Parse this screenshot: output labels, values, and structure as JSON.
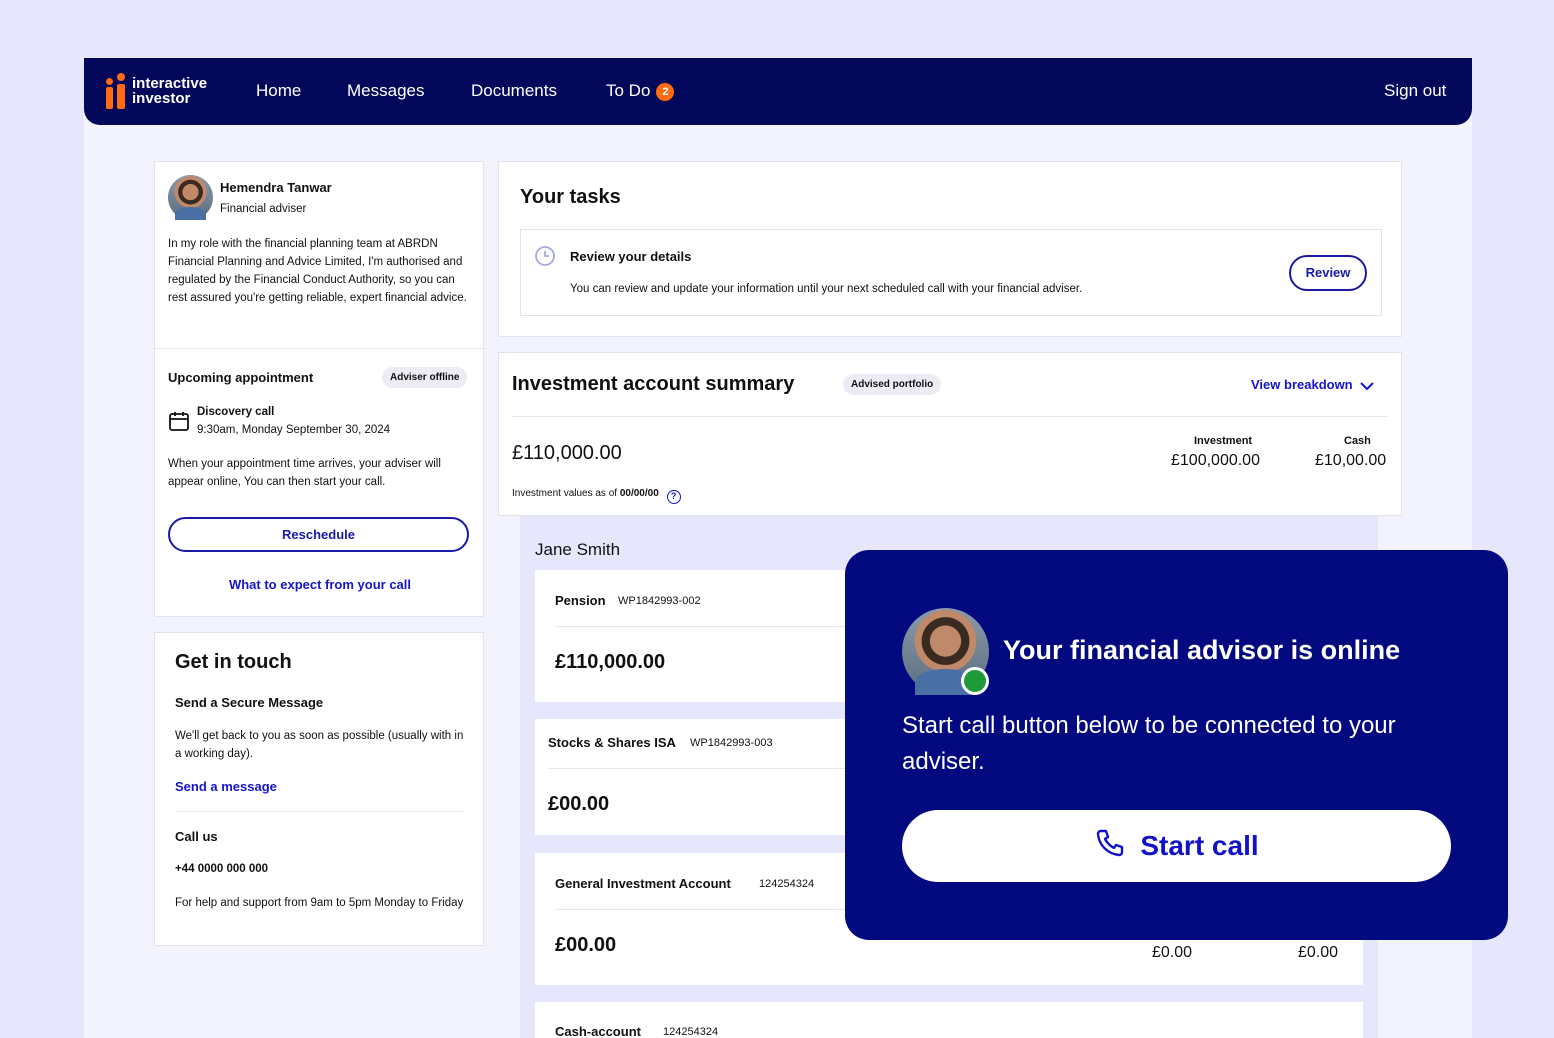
{
  "nav": {
    "logo_line1": "interactive",
    "logo_line2": "investor",
    "home": "Home",
    "messages": "Messages",
    "documents": "Documents",
    "todo": "To Do",
    "todo_count": "2",
    "sign_out": "Sign out"
  },
  "adviser": {
    "name": "Hemendra Tanwar",
    "role": "Financial adviser",
    "bio": "In my role with the financial planning team at ABRDN Financial Planning and Advice Limited, I'm authorised and regulated by the Financial Conduct Authority, so you can rest assured you're getting reliable, expert financial advice."
  },
  "appointment": {
    "heading": "Upcoming appointment",
    "status": "Adviser offline",
    "type": "Discovery call",
    "datetime": "9:30am, Monday September 30, 2024",
    "note": "When your appointment time arrives, your adviser will appear online, You can then start your call.",
    "reschedule": "Reschedule",
    "expect_link": "What to expect from your call"
  },
  "contact": {
    "heading": "Get in touch",
    "secure_heading": "Send a Secure Message",
    "secure_text": "We'll get back to you as soon as possible (usually with in a working day).",
    "send_link": "Send a message",
    "call_heading": "Call us",
    "phone": "+44 0000 000 000",
    "hours": "For help and support from 9am to 5pm Monday to Friday"
  },
  "tasks": {
    "heading": "Your tasks",
    "item_title": "Review your details",
    "item_text": "You can review and update your information until your next scheduled call with your financial adviser.",
    "review_btn": "Review"
  },
  "summary": {
    "heading": "Investment account summary",
    "tag": "Advised portfolio",
    "view_breakdown": "View breakdown",
    "total": "£110,000.00",
    "investment_label": "Investment",
    "investment_value": "£100,000.00",
    "cash_label": "Cash",
    "cash_value": "£10,00.00",
    "values_note": "Investment values as of",
    "values_date": "00/00/00"
  },
  "accounts": {
    "owner": "Jane Smith",
    "items": [
      {
        "name": "Pension",
        "ref": "WP1842993-002",
        "value": "£110,000.00"
      },
      {
        "name": "Stocks & Shares ISA",
        "ref": "WP1842993-003",
        "value": "£00.00"
      },
      {
        "name": "General Investment Account",
        "ref": "124254324",
        "value": "£00.00",
        "col1": "£0.00",
        "col2": "£0.00"
      },
      {
        "name": "Cash-account",
        "ref": "124254324"
      }
    ]
  },
  "popup": {
    "title": "Your financial advisor is online",
    "text": "Start call button below to be connected to your adviser.",
    "button": "Start call"
  },
  "colors": {
    "navy": "#03085a",
    "popup_blue": "#03097f",
    "accent_orange": "#ff6a13",
    "link_blue": "#1515c9",
    "online_green": "#1e9a3a"
  }
}
